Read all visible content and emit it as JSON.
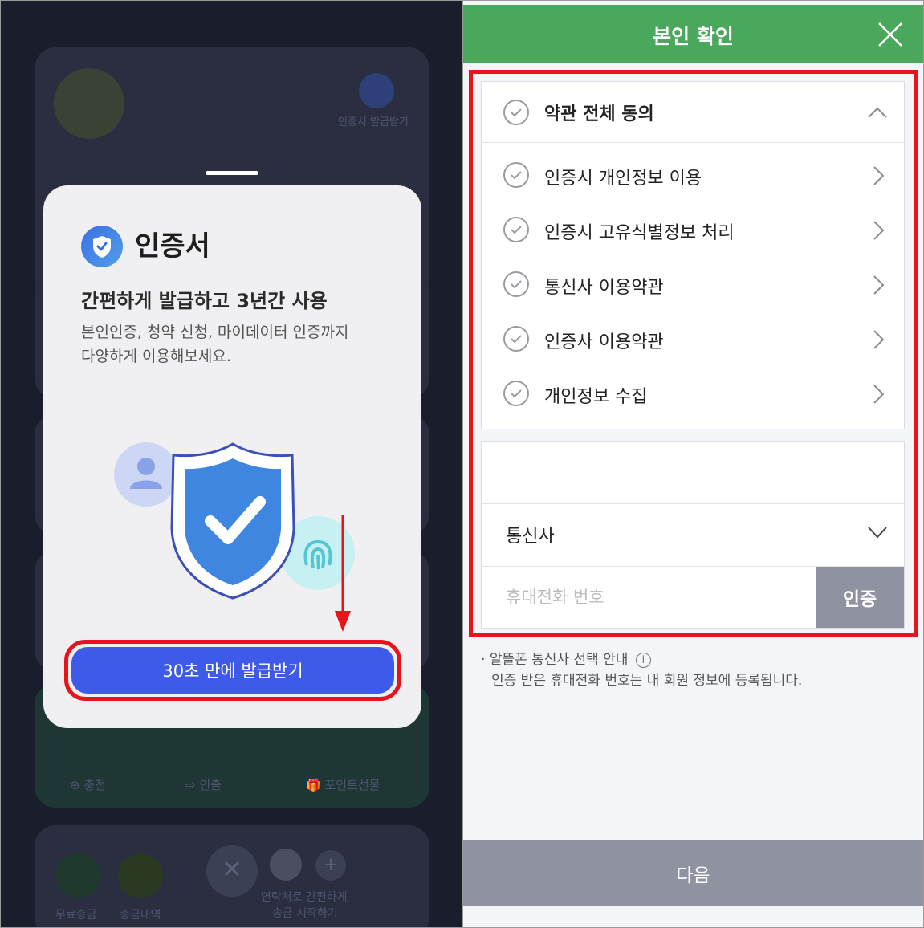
{
  "left": {
    "background_app": {
      "issue_cert_label": "인증서 발급받기",
      "charge_label": "충전",
      "withdraw_label": "인출",
      "gift_label": "포인트선물",
      "free_transfer_label": "무료송금",
      "history_label": "송금내역",
      "contact_transfer_line1": "연락처로 간편하게",
      "contact_transfer_line2": "송금 시작하기"
    },
    "sheet": {
      "title": "인증서",
      "headline": "간편하게 발급하고 3년간 사용",
      "desc_line1": "본인인증, 청약 신청, 마이데이터 인증까지",
      "desc_line2": "다양하게 이용해보세요.",
      "issue_button": "30초 만에 발급받기"
    }
  },
  "right": {
    "header_title": "본인 확인",
    "terms": {
      "all_agree": "약관 전체 동의",
      "items": [
        "인증시 개인정보 이용",
        "인증시 고유식별정보 처리",
        "통신사 이용약관",
        "인증사 이용약관",
        "개인정보 수집"
      ]
    },
    "form": {
      "carrier_label": "통신사",
      "phone_placeholder": "휴대전화 번호",
      "verify_button": "인증"
    },
    "notice_line1": "알뜰폰 통신사 선택 안내",
    "notice_info_icon": "i",
    "notice_line2": "인증 받은 휴대전화 번호는 내 회원 정보에 등록됩니다.",
    "next_button": "다음"
  },
  "colors": {
    "header_green": "#4aa85c",
    "highlight_red": "#e8141c",
    "primary_blue": "#3e5ae8",
    "disabled_gray": "#8f93a1"
  }
}
